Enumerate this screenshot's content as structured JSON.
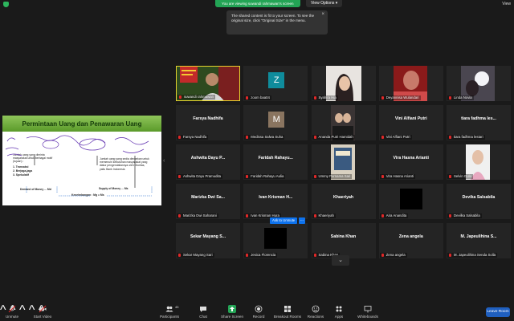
{
  "top": {
    "viewing": "You are viewing suwandi rahmawan's screen",
    "view_options": "View Options",
    "view_options_caret": "▾",
    "view": "View",
    "tooltip": "The shared content is fit to your screen. To see the original size, click \"Original Size\" in the menu.",
    "tooltip_close": "×"
  },
  "slide": {
    "title": "Permintaan Uang dan Penawaran Uang",
    "left_text": "Jumlah uang yang diminta masyarakat untuk berbagai motif (tujuan) :",
    "list": [
      "1.  Transaksi",
      "2.  Berjaga-jaga",
      "3.  Spekulatif"
    ],
    "right_text": "Jumlah uang yang sedia diedarkan untuk memenuhi kebutuhan masyarakat yang diatur pengendaliannya oleh Otoritas, yaitu Bank Indonesia",
    "demand": "Demand of Money ... Md",
    "supply": "Supply of Money ... Ms",
    "equilibrium": "Keseimbangan : Mg = Ms",
    "handle": "‹"
  },
  "tiles": [
    {
      "label": "suwandi rahmawan",
      "big": "",
      "type": "video-main"
    },
    {
      "label": "zoom baa04",
      "big": "",
      "type": "letter",
      "letter": "Z",
      "letter_bg": "#0f8c9c"
    },
    {
      "label": "Syahira Hia",
      "big": "",
      "type": "photo-girl"
    },
    {
      "label": "Deyannisa Wulandari",
      "big": "",
      "type": "photo-red"
    },
    {
      "label": "Linda Novia",
      "big": "",
      "type": "photo-window"
    },
    {
      "label": "Farsya Nadhifa",
      "big": "Farsya Nadhifa",
      "type": "name"
    },
    {
      "label": "Medissa Salwa Suha",
      "big": "",
      "type": "letter",
      "letter": "M",
      "letter_bg": "#8a7560"
    },
    {
      "label": "Ananda Putri Hamidah",
      "big": "",
      "type": "photo-two"
    },
    {
      "label": "Vini Alfiani Putri",
      "big": "Vini Alfiani Putri",
      "type": "name"
    },
    {
      "label": "tiara fadhma lestari",
      "big": "tiara fadhma les...",
      "type": "name"
    },
    {
      "label": "Ashwita Dayu Pramudita",
      "big": "Ashwita Dayu P...",
      "type": "name"
    },
    {
      "label": "Faridah Rahayu Aulia",
      "big": "Faridah Rahayu...",
      "type": "name"
    },
    {
      "label": "Ummy Purnama Sari",
      "big": "",
      "type": "photo-cover"
    },
    {
      "label": "Vira Hasna Arianti",
      "big": "Vira Hasna Arianti",
      "type": "name"
    },
    {
      "label": "Selvin Gulo",
      "big": "",
      "type": "photo-selvin"
    },
    {
      "label": "Marizka Dwi Saharani",
      "big": "Marizka Dwi Sa...",
      "type": "name"
    },
    {
      "label": "Ivan Krisman Hura",
      "big": "Ivan Krisman H...",
      "type": "name"
    },
    {
      "label": "Khaeriyah",
      "big": "Khaeriyah",
      "type": "name"
    },
    {
      "label": "Aira Anandita",
      "big": "",
      "type": "black"
    },
    {
      "label": "Devilka Salsabila",
      "big": "Devika Salsabila",
      "type": "name"
    },
    {
      "label": "Sekar Mayang Sari",
      "big": "Sekar Mayang S...",
      "type": "name"
    },
    {
      "label": "Jesica Florencia",
      "big": "",
      "type": "black"
    },
    {
      "label": "Sabina Khan",
      "big": "Sabina Khan",
      "type": "name"
    },
    {
      "label": "Zena angela",
      "big": "Zena angela",
      "type": "name"
    },
    {
      "label": "M. Japeulihina Senda Solla",
      "big": "M. Japeulihina S...",
      "type": "name"
    }
  ],
  "ask_unmute": "Ask to Unmute",
  "ask_more": "...",
  "pager": "⌄",
  "toolbar": {
    "unmute": "Unmute",
    "start_video": "Start Video",
    "participants": "Participants",
    "participants_count": "45",
    "chat": "Chat",
    "share_screen": "Share Screen",
    "record": "Record",
    "breakout": "Breakout Rooms",
    "reactions": "Reactions",
    "apps": "Apps",
    "whiteboards": "Whiteboards",
    "leave": "Leave Room"
  },
  "icons": {
    "shield": "shield-icon",
    "mic_muted": "mic-muted-icon",
    "video_off": "video-off-icon",
    "participants": "participants-icon",
    "chat": "chat-icon",
    "share": "share-screen-icon",
    "record": "record-icon",
    "breakout": "breakout-rooms-icon",
    "reactions": "reactions-icon",
    "apps": "apps-icon",
    "whiteboards": "whiteboards-icon"
  },
  "colors": {
    "accent_green": "#23a455",
    "active_speaker": "#e6d42d",
    "muted_red": "#e02828",
    "leave_blue": "#1f5fbf"
  }
}
